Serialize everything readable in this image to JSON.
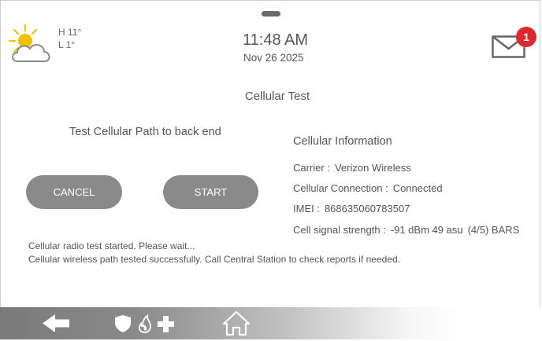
{
  "header": {
    "weather": {
      "high": "H 11°",
      "low": "L 1°",
      "icon": "partly-cloudy-icon"
    },
    "time": "11:48 AM",
    "date": "Nov 26 2025",
    "messages": {
      "icon": "envelope-icon",
      "unread_count": "1",
      "badge_color": "#e0262e"
    }
  },
  "page": {
    "title": "Cellular Test",
    "test_heading": "Test Cellular Path to back end",
    "buttons": {
      "cancel": "CANCEL",
      "start": "START"
    }
  },
  "cellular_info": {
    "heading": "Cellular Information",
    "carrier_label": "Carrier :",
    "carrier_value": "Verizon Wireless",
    "connection_label": "Cellular Connection :",
    "connection_value": "Connected",
    "imei_label": "IMEI :",
    "imei_value": "868635060783507",
    "signal_label": "Cell signal strength :",
    "signal_value": "-91 dBm 49 asu",
    "signal_bars": "(4/5) BARS"
  },
  "log": [
    "Cellular radio test started. Please wait...",
    "Cellular wireless path tested successfully. Call Central Station to check reports if needed."
  ],
  "navbar": {
    "items": [
      "back-arrow-icon",
      "security-icon",
      "home-icon"
    ]
  },
  "colors": {
    "button": "#8a8a8a",
    "text": "#555555",
    "badge": "#e0262e"
  }
}
